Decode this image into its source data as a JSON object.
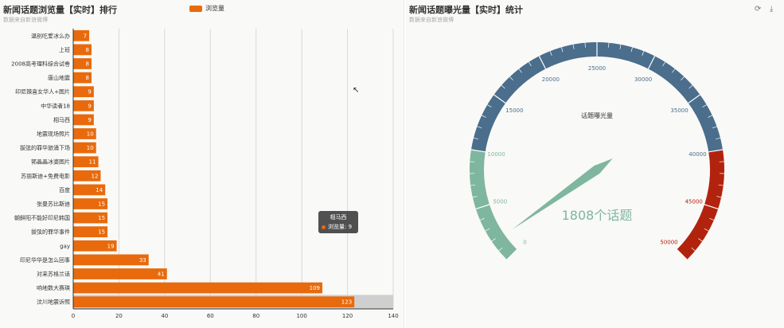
{
  "left_panel": {
    "title": "新闻话题浏览量【实时】排行",
    "subtitle": "数据来自新浪微博",
    "legend_label": "浏览量",
    "tooltip": {
      "name": "相马西",
      "series": "浏览量",
      "value": "9"
    }
  },
  "right_panel": {
    "title": "新闻话题曝光量【实时】统计",
    "subtitle": "数据来自新浪微博",
    "icons": [
      "refresh-icon",
      "download-icon"
    ]
  },
  "chart_data": [
    {
      "type": "bar",
      "orientation": "horizontal",
      "title": "新闻话题浏览量【实时】排行",
      "subtitle": "数据来自新浪微博",
      "legend": [
        "浏览量"
      ],
      "categories": [
        "温别吃爱冰么办",
        "上班",
        "2008高考理科综合试卷",
        "唐山地震",
        "印尼辣喜女华人+图片",
        "中华读者18",
        "相马西",
        "地震现场照片",
        "拔弦的罪华旅涌下场",
        "郭晶晶冰婆图片",
        "苏丽斯迪+免费电影",
        "百度",
        "张曼苏比斯迪",
        "朝鲜阳不能好印尼韩国",
        "拔弦的罪华事件",
        "gay",
        "印尼华华是怎么回事",
        "对来苏格兰话",
        "响地数大赛瑛",
        "汶川地震诉照"
      ],
      "values": [
        7,
        8,
        8,
        8,
        9,
        9,
        9,
        10,
        10,
        11,
        12,
        14,
        15,
        15,
        15,
        19,
        33,
        41,
        109,
        123
      ],
      "xlim": [
        0,
        140
      ],
      "xticks": [
        0,
        20,
        40,
        60,
        80,
        100,
        120,
        140
      ],
      "highlighted_category": "汶川地震诉照",
      "color": "#e86a0c"
    },
    {
      "type": "gauge",
      "title": "新闻话题曝光量【实时】统计",
      "subtitle": "数据来自新浪微博",
      "gauge_label": "话题曝光量",
      "value": 1808,
      "detail_text": "1808个话题",
      "min": 0,
      "max": 50000,
      "ticks": [
        0,
        5000,
        10000,
        15000,
        20000,
        25000,
        30000,
        35000,
        40000,
        45000,
        50000
      ],
      "bands": [
        {
          "to": 0.2,
          "color": "#7fb69f"
        },
        {
          "to": 0.8,
          "color": "#4a6e8c"
        },
        {
          "to": 1.0,
          "color": "#b2230e"
        }
      ]
    }
  ]
}
